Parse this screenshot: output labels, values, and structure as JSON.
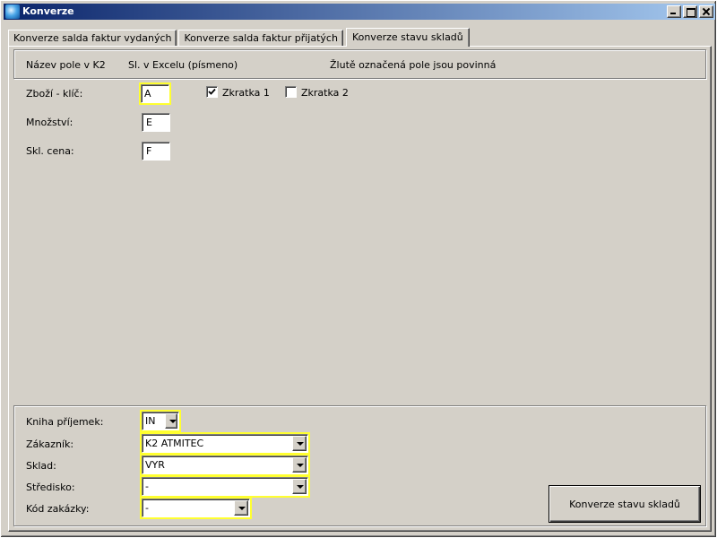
{
  "window": {
    "title": "Konverze",
    "icon": "app-icon",
    "buttons": [
      "minimize",
      "maximize",
      "close"
    ]
  },
  "tabs": [
    {
      "label": "Konverze salda faktur vydaných",
      "active": false
    },
    {
      "label": "Konverze salda faktur přijatých",
      "active": false
    },
    {
      "label": "Konverze stavu skladů",
      "active": true
    }
  ],
  "header": {
    "col_name": "Název pole v K2",
    "col_excel": "Sl. v Excelu (písmeno)",
    "note": "Žlutě označená pole jsou povinná"
  },
  "fields": [
    {
      "label": "Zboží - klíč:",
      "value": "A",
      "required": true
    },
    {
      "label": "Množství:",
      "value": "E",
      "required": false
    },
    {
      "label": "Skl. cena:",
      "value": "F",
      "required": false
    }
  ],
  "checkboxes": [
    {
      "label": "Zkratka 1",
      "checked": true
    },
    {
      "label": "Zkratka 2",
      "checked": false
    }
  ],
  "bottom_fields": [
    {
      "label": "Kniha příjemek:",
      "value": "IN"
    },
    {
      "label": "Zákazník:",
      "value": "K2 ATMITEC"
    },
    {
      "label": "Sklad:",
      "value": "VYR"
    },
    {
      "label": "Středisko:",
      "value": "-"
    },
    {
      "label": "Kód zakázky:",
      "value": "-"
    }
  ],
  "action_button": {
    "label": "Konverze stavu skladů"
  },
  "colors": {
    "required_highlight": "#ffff30",
    "title_bar": "#0a246a",
    "face": "#d4d0c8"
  }
}
